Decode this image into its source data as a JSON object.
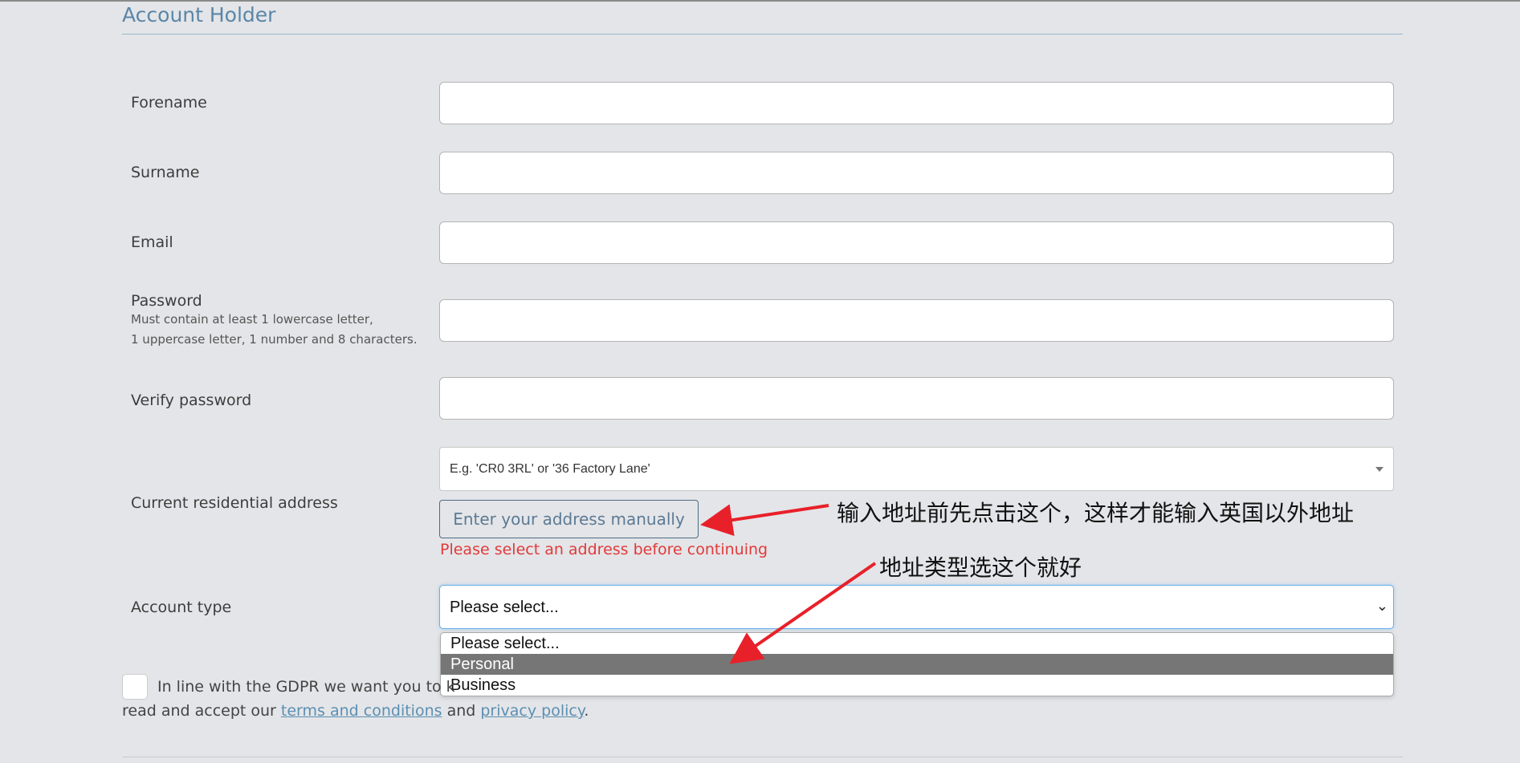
{
  "section": {
    "title": "Account Holder"
  },
  "fields": {
    "forename": {
      "label": "Forename",
      "value": ""
    },
    "surname": {
      "label": "Surname",
      "value": ""
    },
    "email": {
      "label": "Email",
      "value": ""
    },
    "password": {
      "label": "Password",
      "hint_line1": "Must contain at least 1 lowercase letter,",
      "hint_line2": "1 uppercase letter, 1 number and 8 characters.",
      "value": ""
    },
    "verify_password": {
      "label": "Verify password",
      "value": ""
    }
  },
  "address": {
    "label": "Current residential address",
    "placeholder": "E.g. 'CR0 3RL' or '36 Factory Lane'",
    "manual_button": "Enter your address manually",
    "error": "Please select an address before continuing"
  },
  "account_type": {
    "label": "Account type",
    "selected": "Please select...",
    "options": [
      "Please select...",
      "Personal",
      "Business"
    ],
    "highlighted": "Personal"
  },
  "gdpr": {
    "text_visible": "In line with the GDPR we want you to k",
    "line2_prefix": "read and accept our",
    "terms_link": "terms and conditions",
    "and": "and",
    "privacy_link": "privacy policy",
    "suffix": "."
  },
  "annotations": {
    "manual_note": "输入地址前先点击这个，这样才能输入英国以外地址",
    "type_note": "地址类型选这个就好"
  },
  "colors": {
    "background": "#e4e5e8",
    "accent": "#5a86a8",
    "error": "#e03a3a",
    "annotation_arrow": "#e8202a",
    "highlight": "#767676"
  }
}
